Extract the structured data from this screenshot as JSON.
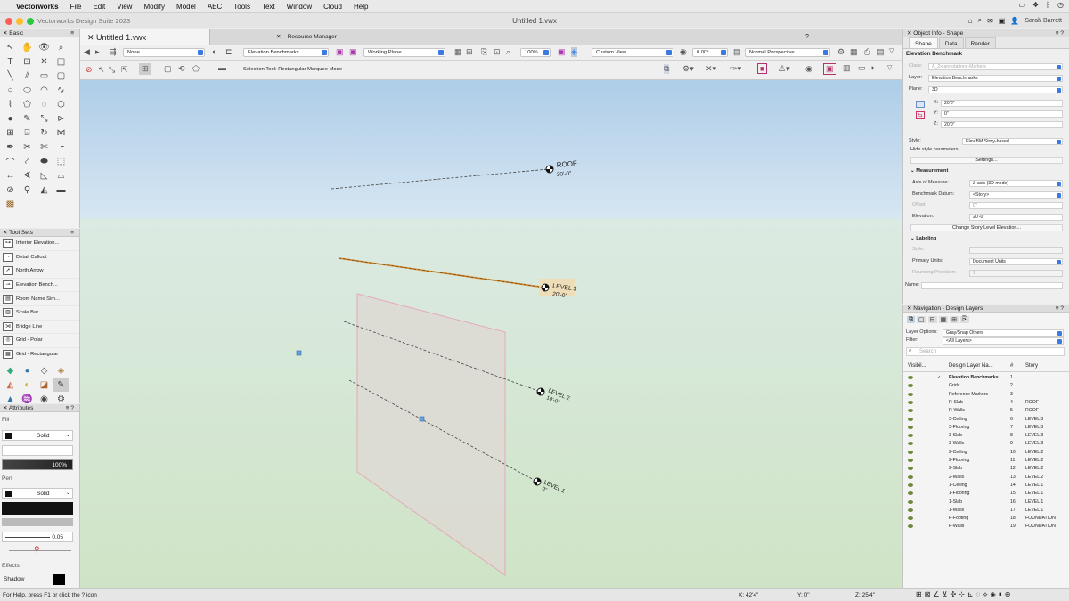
{
  "menubar": {
    "app": "Vectorworks",
    "items": [
      "File",
      "Edit",
      "View",
      "Modify",
      "Model",
      "AEC",
      "Tools",
      "Text",
      "Window",
      "Cloud",
      "Help"
    ]
  },
  "window": {
    "app_title": "Vectorworks Design Suite 2023",
    "doc_title": "Untitled 1.vwx",
    "user": "Sarah Barrett"
  },
  "basic_palette": {
    "title": "Basic"
  },
  "tool_sets": {
    "title": "Tool Sets",
    "items": [
      "Interior Elevation...",
      "Detail Callout",
      "North Arrow",
      "Elevation Bench...",
      "Room Name Sim...",
      "Scale Bar",
      "Bridge Line",
      "Grid - Polar",
      "Grid - Rectangular"
    ]
  },
  "attributes": {
    "title": "Attributes",
    "fill_label": "Fill",
    "fill_style": "Solid",
    "opacity": "100%",
    "pen_label": "Pen",
    "pen_style": "Solid",
    "line_weight": "0.05",
    "effects_label": "Effects",
    "shadow_label": "Shadow"
  },
  "doc_tab": {
    "label": "Untitled 1.vwx"
  },
  "resource_manager": {
    "label": "Resource Manager",
    "help": "?"
  },
  "toolbar": {
    "class_value": "None",
    "layer_value": "Elevation Benchmarks",
    "plane_value": "Working Plane",
    "zoom": "100%",
    "view_value": "Custom View",
    "rotation": "0.00°",
    "render_value": "Normal Perspective",
    "mode_text": "Selection Tool: Rectangular Marquee Mode"
  },
  "viewport": {
    "markers": [
      {
        "name": "ROOF",
        "elev": "30'-0\""
      },
      {
        "name": "LEVEL 3",
        "elev": "20'-0\""
      },
      {
        "name": "LEVEL 2",
        "elev": "10'-0\""
      },
      {
        "name": "LEVEL 1",
        "elev": "0\""
      }
    ]
  },
  "object_info": {
    "title": "Object Info - Shape",
    "tabs": [
      "Shape",
      "Data",
      "Render"
    ],
    "object_type": "Elevation Benchmark",
    "class_label": "Class:",
    "class_value": "A_2x-annotations-Markers",
    "layer_label": "Layer:",
    "layer_value": "Elevation Benchmarks",
    "plane_label": "Plane:",
    "plane_value": "3D",
    "x_label": "X:",
    "x_value": "20'0\"",
    "y_label": "Y:",
    "y_value": "0\"",
    "z_label": "Z:",
    "z_value": "20'0\"",
    "style_label": "Style:",
    "style_value": "Elev BM Story-based",
    "hide_style": "Hide style parameters",
    "settings": "Settings...",
    "measurement": "Measurement",
    "axis_label": "Axis of Measure:",
    "axis_value": "Z-axis (3D mode)",
    "datum_label": "Benchmark Datum:",
    "datum_value": "<Story>",
    "offset_label": "Offset:",
    "offset_value": "0\"",
    "elevation_label": "Elevation:",
    "elevation_value": "20'-0\"",
    "change_story": "Change Story Level Elevation...",
    "labeling": "Labeling",
    "style2_label": "Style:",
    "units_label": "Primary Units:",
    "units_value": "Document Units",
    "rounding_label": "Rounding Precision:",
    "rounding_value": "1",
    "name_label": "Name:"
  },
  "navigation": {
    "title": "Navigation - Design Layers",
    "layer_options_label": "Layer Options:",
    "layer_options_value": "Gray/Snap Others",
    "filter_label": "Filter:",
    "filter_value": "<All Layers>",
    "search_placeholder": "Search",
    "col_vis": "Visibil...",
    "col_name": "Design Layer Na...",
    "col_num": "#",
    "col_story": "Story",
    "layers": [
      {
        "name": "Elevation Benchmarks",
        "num": "1",
        "story": ""
      },
      {
        "name": "Grids",
        "num": "2",
        "story": ""
      },
      {
        "name": "Reference Markers",
        "num": "3",
        "story": ""
      },
      {
        "name": "R-Slab",
        "num": "4",
        "story": "ROOF"
      },
      {
        "name": "R-Walls",
        "num": "5",
        "story": "ROOF"
      },
      {
        "name": "3-Ceiling",
        "num": "6",
        "story": "LEVEL 3"
      },
      {
        "name": "3-Flooring",
        "num": "7",
        "story": "LEVEL 3"
      },
      {
        "name": "3-Slab",
        "num": "8",
        "story": "LEVEL 3"
      },
      {
        "name": "3-Walls",
        "num": "9",
        "story": "LEVEL 3"
      },
      {
        "name": "2-Ceiling",
        "num": "10",
        "story": "LEVEL 2"
      },
      {
        "name": "2-Flooring",
        "num": "11",
        "story": "LEVEL 2"
      },
      {
        "name": "2-Slab",
        "num": "12",
        "story": "LEVEL 2"
      },
      {
        "name": "2-Walls",
        "num": "13",
        "story": "LEVEL 2"
      },
      {
        "name": "1-Ceiling",
        "num": "14",
        "story": "LEVEL 1"
      },
      {
        "name": "1-Flooring",
        "num": "15",
        "story": "LEVEL 1"
      },
      {
        "name": "1-Slab",
        "num": "16",
        "story": "LEVEL 1"
      },
      {
        "name": "1-Walls",
        "num": "17",
        "story": "LEVEL 1"
      },
      {
        "name": "F-Footing",
        "num": "18",
        "story": "FOUNDATION"
      },
      {
        "name": "F-Walls",
        "num": "19",
        "story": "FOUNDATION"
      }
    ]
  },
  "status": {
    "help_text": "For Help, press F1 or click the ? icon",
    "x": "X: 42'4\"",
    "y": "Y: 0\"",
    "z": "Z: 25'4\""
  }
}
